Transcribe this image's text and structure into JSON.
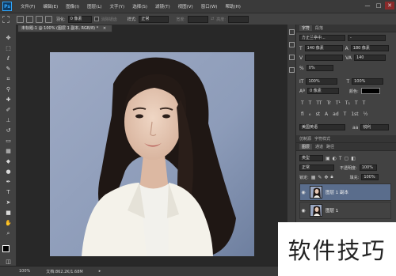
{
  "app": {
    "logo": "Ps"
  },
  "menu": [
    "文件(F)",
    "编辑(E)",
    "图像(I)",
    "图层(L)",
    "文字(Y)",
    "选择(S)",
    "滤镜(T)",
    "视图(V)",
    "窗口(W)",
    "帮助(H)"
  ],
  "window_controls": {
    "minimize": "—",
    "maximize": "□",
    "close": "✕"
  },
  "options_bar": {
    "feather_label": "羽化:",
    "feather_value": "0 像素",
    "antialias_label": "消除锯齿",
    "style_label": "样式:",
    "style_value": "正常",
    "width_label": "宽度:",
    "height_label": "高度:"
  },
  "document": {
    "tab_title": "未标题-1 @ 100% (图层 1 副本, RGB/8) *",
    "tab_close": "×"
  },
  "status": {
    "zoom": "100%",
    "doc_size": "文档:862.2K/1.68M",
    "arrow": "▸"
  },
  "character_panel": {
    "tabs": [
      "字符",
      "段落"
    ],
    "font_family": "方正兰亭中...",
    "font_style": "-",
    "font_size": "140 像素",
    "leading": "180 像素",
    "kerning": "0%",
    "tracking": "140",
    "vscale": "100%",
    "hscale": "100%",
    "baseline": "0 像素",
    "color_label": "颜色:",
    "language": "美国英语",
    "antialias": "锐利",
    "style_buttons": [
      "T",
      "T",
      "TT",
      "Tr",
      "T¹",
      "T₁",
      "T",
      "T"
    ],
    "opentype_buttons": [
      "fi",
      "ℴ",
      "st",
      "A",
      "ad",
      "T",
      "1st",
      "½"
    ]
  },
  "layers_panel": {
    "tabs_top": [
      "仿制源",
      "字符样式"
    ],
    "tabs": [
      "图层",
      "通道",
      "路径"
    ],
    "kind_label": "类型",
    "blend_mode": "正常",
    "opacity_label": "不透明度:",
    "opacity_value": "100%",
    "lock_label": "锁定:",
    "fill_label": "填充:",
    "fill_value": "100%",
    "layers": [
      {
        "name": "图层 1 副本",
        "selected": true,
        "visible": true
      },
      {
        "name": "图层 1",
        "selected": false,
        "visible": true
      }
    ]
  },
  "watermark": {
    "text": "软件技巧"
  },
  "colors": {
    "accent": "#31a8ff",
    "selected_layer": "#5a6d8c",
    "panel": "#424242",
    "canvas_bg": "#282828"
  }
}
